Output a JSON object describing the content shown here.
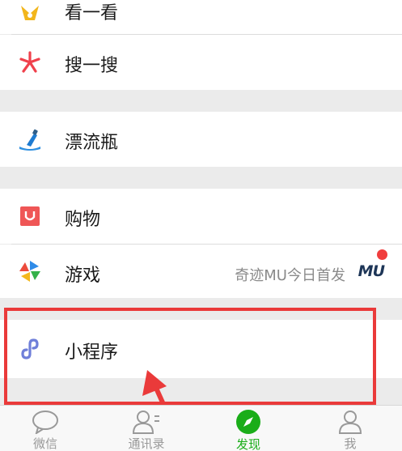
{
  "menu": {
    "items": [
      {
        "id": "kanyikan",
        "label": "看一看",
        "icon": "kanyikan-icon"
      },
      {
        "id": "souyisou",
        "label": "搜一搜",
        "icon": "souyisou-icon"
      },
      {
        "id": "piaoliuping",
        "label": "漂流瓶",
        "icon": "drift-bottle-icon"
      },
      {
        "id": "gouwu",
        "label": "购物",
        "icon": "shopping-icon"
      },
      {
        "id": "youxi",
        "label": "游戏",
        "icon": "game-icon",
        "promo_text": "奇迹MU今日首发",
        "promo_badge": "MU",
        "has_red_dot": true
      },
      {
        "id": "xiaochengxu",
        "label": "小程序",
        "icon": "mini-program-icon"
      }
    ]
  },
  "tabbar": {
    "tabs": [
      {
        "label": "微信",
        "icon": "chat-icon",
        "active": false
      },
      {
        "label": "通讯录",
        "icon": "contacts-icon",
        "active": false
      },
      {
        "label": "发现",
        "icon": "discover-compass-icon",
        "active": true
      },
      {
        "label": "我",
        "icon": "profile-icon",
        "active": false
      }
    ]
  },
  "colors": {
    "highlight": "#ea3a3a",
    "active_tab": "#1aad19",
    "background": "#ebebeb"
  }
}
